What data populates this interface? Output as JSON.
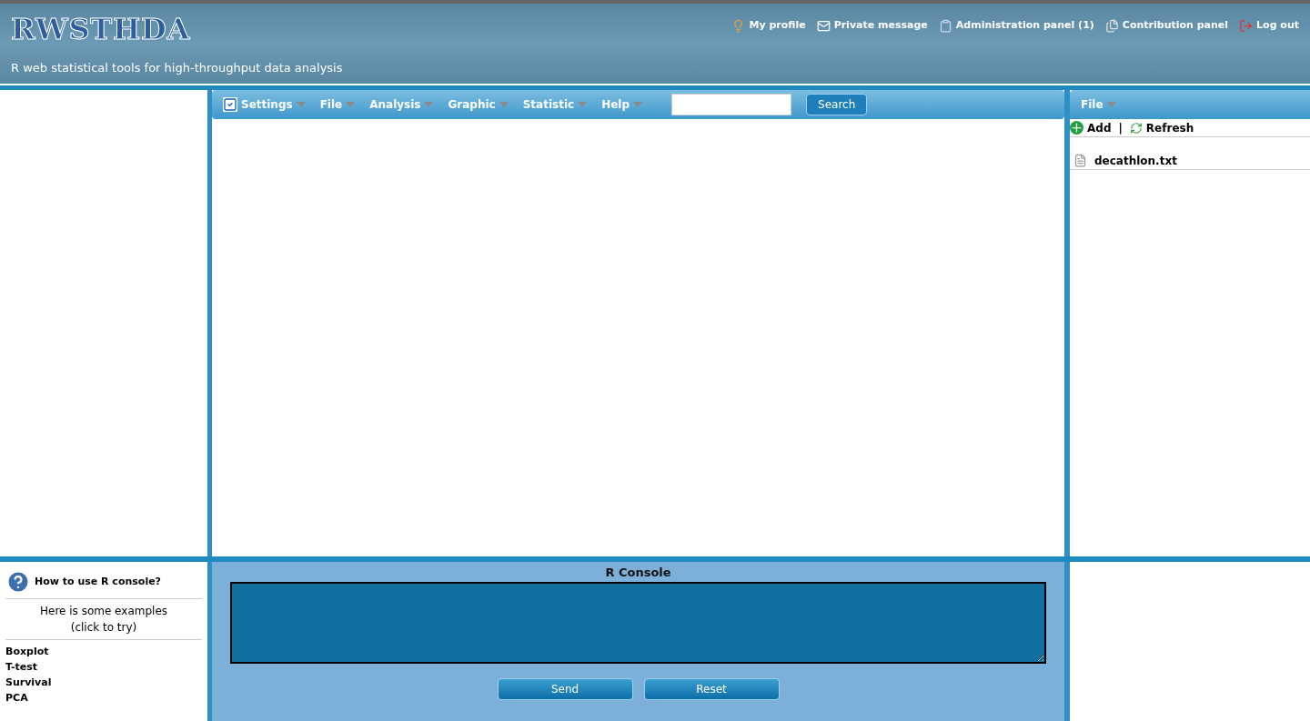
{
  "header": {
    "logo": "RWSTHDA",
    "subtitle": "R web statistical tools for high-throughput data analysis",
    "links": [
      {
        "kind": "profile",
        "label": "My profile"
      },
      {
        "kind": "message",
        "label": "Private message"
      },
      {
        "kind": "admin",
        "label": "Administration panel (1)"
      },
      {
        "kind": "contribution",
        "label": "Contribution panel"
      },
      {
        "kind": "logout",
        "label": "Log out"
      }
    ]
  },
  "menu": {
    "items": [
      {
        "label": "Settings",
        "icon": true
      },
      {
        "label": "File",
        "icon": false
      },
      {
        "label": "Analysis",
        "icon": false
      },
      {
        "label": "Graphic",
        "icon": false
      },
      {
        "label": "Statistic",
        "icon": false
      },
      {
        "label": "Help",
        "icon": false
      }
    ],
    "search_button": "Search"
  },
  "file_panel": {
    "menu": "File",
    "actions": [
      {
        "kind": "add",
        "label": "Add"
      },
      {
        "kind": "refresh",
        "label": "Refresh"
      }
    ],
    "separator": "|",
    "files": [
      "decathlon.txt"
    ]
  },
  "help_panel": {
    "title": "How to use R console?",
    "intro": "Here is some examples",
    "intro_hint": "(click to try)",
    "examples": [
      "Boxplot",
      "T-test",
      "Survival",
      "PCA"
    ]
  },
  "console": {
    "title": "R Console",
    "buttons": [
      "Send",
      "Reset"
    ]
  }
}
